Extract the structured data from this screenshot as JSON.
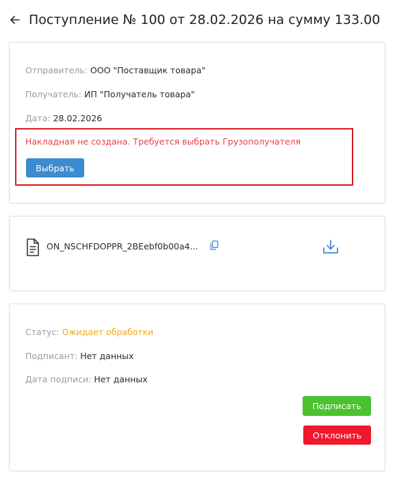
{
  "header": {
    "title": "Поступление № 100 от 28.02.2026 на сумму 133.00"
  },
  "info": {
    "sender_label": "Отправитель:",
    "sender_value": "ООО \"Поставщик товара\"",
    "recipient_label": "Получатель:",
    "recipient_value": "ИП \"Получатель товара\"",
    "date_label": "Дата:",
    "date_value": "28.02.2026",
    "alert_text": "Накладная не создана. Требуется выбрать Грузополучателя",
    "select_label": "Выбрать"
  },
  "file": {
    "name": "ON_NSCHFDOPPR_2BEebf0b00a4..."
  },
  "signing": {
    "status_label": "Статус:",
    "status_value": "Ожидает обработки",
    "signer_label": "Подписант:",
    "signer_value": "Нет данных",
    "sign_date_label": "Дата подписи:",
    "sign_date_value": "Нет данных",
    "sign_label": "Подписать",
    "reject_label": "Отклонить"
  },
  "colors": {
    "accent_blue": "#3d8bd0",
    "alert_red": "#d7191f",
    "status_orange": "#f3a71e",
    "sign_green": "#4cc22f",
    "reject_red": "#f0182b"
  },
  "icons": {
    "back": "arrow-left-icon",
    "file": "document-icon",
    "copy": "copy-icon",
    "download": "download-icon"
  }
}
